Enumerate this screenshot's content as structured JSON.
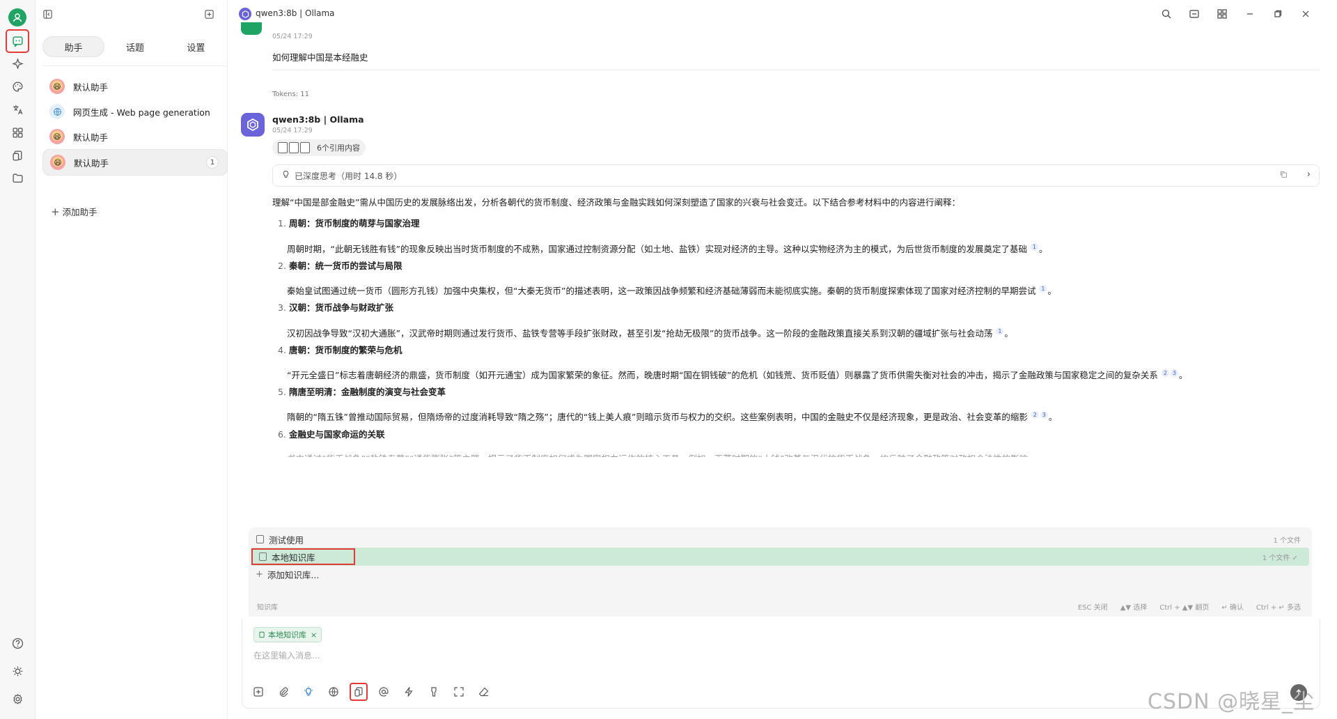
{
  "app": {
    "window_title": "qwen3:8b | Ollama"
  },
  "sidebar_tabs": [
    "助手",
    "话题",
    "设置"
  ],
  "assistants": [
    {
      "name": "默认助手",
      "icon": "emoji-face-icon"
    },
    {
      "name": "网页生成 - Web page generation",
      "icon": "globe-icon"
    },
    {
      "name": "默认助手",
      "icon": "emoji-face-icon"
    },
    {
      "name": "默认助手",
      "icon": "emoji-face-icon",
      "badge": "1",
      "selected": true
    }
  ],
  "add_assistant": "添加助手",
  "user_message": {
    "timestamp": "05/24 17:29",
    "text": "如何理解中国是本经融史",
    "tokens": "Tokens: 11"
  },
  "bot_message": {
    "name": "qwen3:8b | Ollama",
    "timestamp": "05/24 17:29",
    "citations_label": "6个引用内容",
    "thinking_label": "已深度思考（用时 14.8 秒）",
    "intro": "理解“中国是部金融史”需从中国历史的发展脉络出发，分析各朝代的货币制度、经济政策与金融实践如何深刻塑造了国家的兴衰与社会变迁。以下结合参考材料中的内容进行阐释：",
    "items": [
      {
        "num": "1.",
        "heading": "周朝：货币制度的萌芽与国家治理",
        "body": "周朝时期，“此朝无钱胜有钱”的现象反映出当时货币制度的不成熟，国家通过控制资源分配（如土地、盐铁）实现对经济的主导。这种以实物经济为主的模式，为后世货币制度的发展奠定了基础",
        "refs": [
          "1"
        ]
      },
      {
        "num": "2.",
        "heading": "秦朝：统一货币的尝试与局限",
        "body": "秦始皇试图通过统一货币（圆形方孔钱）加强中央集权，但“大秦无货币”的描述表明，这一政策因战争频繁和经济基础薄弱而未能彻底实施。秦朝的货币制度探索体现了国家对经济控制的早期尝试",
        "refs": [
          "1"
        ]
      },
      {
        "num": "3.",
        "heading": "汉朝：货币战争与财政扩张",
        "body": "汉初因战争导致“汉初大通胀”，汉武帝时期则通过发行货币、盐铁专营等手段扩张财政，甚至引发“抢劫无极限”的货币战争。这一阶段的金融政策直接关系到汉朝的疆域扩张与社会动荡",
        "refs": [
          "1"
        ]
      },
      {
        "num": "4.",
        "heading": "唐朝：货币制度的繁荣与危机",
        "body": "“开元全盛日”标志着唐朝经济的鼎盛，货币制度（如开元通宝）成为国家繁荣的象征。然而，晚唐时期“国在铜钱破”的危机（如钱荒、货币贬值）则暴露了货币供需失衡对社会的冲击，揭示了金融政策与国家稳定之间的复杂关系",
        "refs": [
          "2",
          "3"
        ]
      },
      {
        "num": "5.",
        "heading": "隋唐至明清：金融制度的演变与社会变革",
        "body": "隋朝的“隋五铢”曾推动国际贸易，但隋炀帝的过度消耗导致“隋之殇”；唐代的“钱上美人痕”则暗示货币与权力的交织。这些案例表明，中国的金融史不仅是经济现象，更是政治、社会变革的缩影",
        "refs": [
          "2",
          "3"
        ]
      },
      {
        "num": "6.",
        "heading": "金融史与国家命运的关联",
        "body": "",
        "refs": []
      }
    ],
    "cut_line": "书中通过“货币战争”“盐铁专营”“通货膨胀”等主题，揭示了货币制度如何成为国家权力运作的核心工具。例如，王莽时期的“大钱”改革与汉代的货币战争，均反映了金融政策对政权合法性的影响"
  },
  "knowledge_popup": {
    "rows": [
      {
        "label": "测试使用",
        "count": "1 个文件",
        "selected": false
      },
      {
        "label": "本地知识库",
        "count": "1 个文件 ✓",
        "selected": true
      }
    ],
    "add_label": "添加知识库...",
    "footer_label": "知识库",
    "hints": [
      "ESC 关闭",
      "▲▼ 选择",
      "Ctrl + ▲▼ 翻页",
      "↵ 确认",
      "Ctrl + ↵ 多选"
    ]
  },
  "input": {
    "chip_label": "本地知识库",
    "placeholder": "在这里输入消息...",
    "tools": [
      "new-topic-icon",
      "attachment-icon",
      "deep-think-icon",
      "web-search-icon",
      "knowledge-base-icon",
      "mention-model-icon",
      "quick-phrase-icon",
      "clear-context-icon",
      "expand-icon",
      "eraser-icon"
    ]
  },
  "watermark": "CSDN @晓星_尘"
}
